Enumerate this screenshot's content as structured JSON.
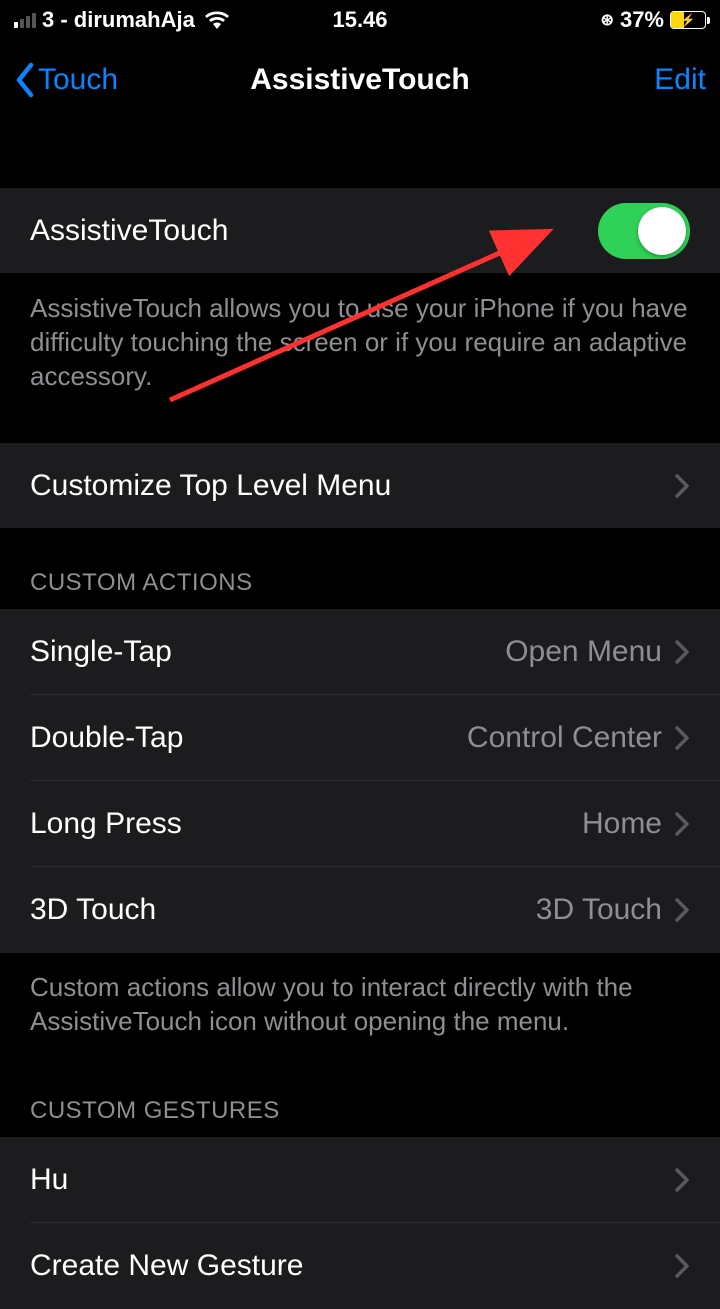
{
  "status": {
    "carrier": "3 - dirumahAja",
    "time": "15.46",
    "battery_percent": "37%"
  },
  "nav": {
    "back_label": "Touch",
    "title": "AssistiveTouch",
    "edit_label": "Edit"
  },
  "main_toggle": {
    "label": "AssistiveTouch",
    "description": "AssistiveTouch allows you to use your iPhone if you have difficulty touching the screen or if you require an adaptive accessory."
  },
  "customize": {
    "label": "Customize Top Level Menu"
  },
  "custom_actions": {
    "header": "CUSTOM ACTIONS",
    "items": [
      {
        "label": "Single-Tap",
        "value": "Open Menu"
      },
      {
        "label": "Double-Tap",
        "value": "Control Center"
      },
      {
        "label": "Long Press",
        "value": "Home"
      },
      {
        "label": "3D Touch",
        "value": "3D Touch"
      }
    ],
    "footer": "Custom actions allow you to interact directly with the AssistiveTouch icon without opening the menu."
  },
  "custom_gestures": {
    "header": "CUSTOM GESTURES",
    "items": [
      {
        "label": "Hu"
      },
      {
        "label": "Create New Gesture"
      }
    ]
  }
}
